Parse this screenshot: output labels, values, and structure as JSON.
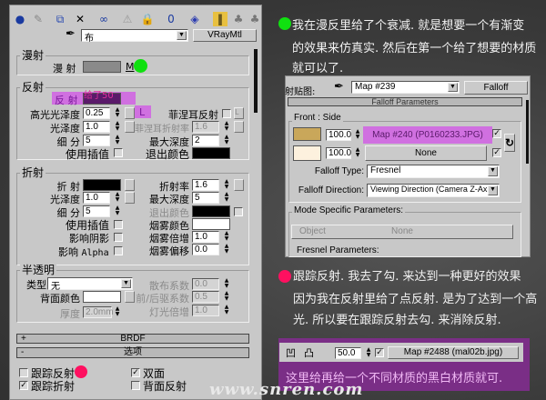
{
  "material_editor": {
    "material_name": "布",
    "material_type": "VRayMtl",
    "diffuse": {
      "title": "漫射",
      "label": "漫 射",
      "map_button": "M",
      "color": "#8a8a8a"
    },
    "reflection": {
      "title": "反射",
      "reflect_label": "反 射",
      "overlay_text": "给了50",
      "hilight_label": "高光光泽度",
      "hilight_value": "0.25",
      "lock_button": "L",
      "gloss_label": "光泽度",
      "gloss_value": "1.0",
      "subdiv_label": "细 分",
      "subdiv_value": "5",
      "interp_label": "使用插值",
      "fresnel_label": "菲涅耳反射",
      "fresnel_lock": "L",
      "fresnel_ior_label": "菲涅耳折射率",
      "fresnel_ior_value": "1.6",
      "maxdepth_label": "最大深度",
      "maxdepth_value": "2",
      "exit_label": "退出颜色"
    },
    "refraction": {
      "title": "折射",
      "refract_label": "折 射",
      "gloss_label": "光泽度",
      "gloss_value": "1.0",
      "subdiv_label": "细 分",
      "subdiv_value": "5",
      "interp_label": "使用插值",
      "shadows_label": "影响阴影",
      "alpha_label": "影响",
      "alpha_suffix": "Alpha",
      "ior_label": "折射率",
      "ior_value": "1.6",
      "maxdepth_label": "最大深度",
      "maxdepth_value": "5",
      "exit_label": "退出颜色",
      "fog_color_label": "烟雾颜色",
      "fog_mult_label": "烟雾倍增",
      "fog_mult_value": "1.0",
      "fog_bias_label": "烟雾偏移",
      "fog_bias_value": "0.0"
    },
    "translucency": {
      "title": "半透明",
      "type_label": "类型",
      "type_value": "无",
      "back_color_label": "背面颜色",
      "thickness_label": "厚度",
      "thickness_value": "2.0mm",
      "scatter_label": "散布系数",
      "scatter_value": "0.0",
      "fb_label": "前/后驱系数",
      "fb_value": "0.5",
      "light_mult_label": "灯光倍增",
      "light_mult_value": "1.0"
    },
    "rollouts": {
      "brdf_sign": "+",
      "brdf": "BRDF",
      "options_sign": "-",
      "options": "选项"
    },
    "options": {
      "trace_refl": "跟踪反射",
      "trace_refl_checked": false,
      "trace_refr": "跟踪折射",
      "trace_refr_checked": true,
      "double_sided": "双面",
      "double_sided_checked": true,
      "back_refl": "背面反射",
      "back_refl_checked": false
    }
  },
  "falloff_editor": {
    "slot_label": "射贴图:",
    "map_name": "Map #239",
    "map_type": "Falloff",
    "rollout": "Falloff Parameters",
    "front_side_label": "Front : Side",
    "amount1": "100.0",
    "map1": "Map #240 (P0160233.JPG)",
    "amount2": "100.0",
    "map2": "None",
    "falloff_type_label": "Falloff Type:",
    "falloff_type": "Fresnel",
    "falloff_dir_label": "Falloff Direction:",
    "falloff_dir": "Viewing Direction (Camera Z-Axis)",
    "mode_label": "Mode Specific Parameters:",
    "object_label": "Object",
    "object_value": "None",
    "fresnel_label": "Fresnel Parameters:",
    "color1": "#c9a75a",
    "color2": "#fdf1de"
  },
  "notes": {
    "green": [
      "我在漫反里给了个衰减. 就是想要一个有渐变",
      "的效果来仿真实. 然后在第一个给了想要的材质",
      "就可以了."
    ],
    "pink": [
      "跟踪反射. 我去了勾. 来达到一种更好的效果",
      "因为我在反射里给了点反射. 是为了达到一个高",
      "光. 所以要在跟踪反射去勾. 来消除反射."
    ],
    "purple": "这里给再给一个不同材质的黑白材质就可."
  },
  "bump_strip": {
    "amount": "50.0",
    "map": "Map #2488 (mal02b.jpg)"
  },
  "watermark": "www.snren.com",
  "colors": {
    "green_dot": "#10e010",
    "pink_dot": "#ff1060",
    "highlight": "#d070e0",
    "purple_box": "#7a2e86"
  }
}
